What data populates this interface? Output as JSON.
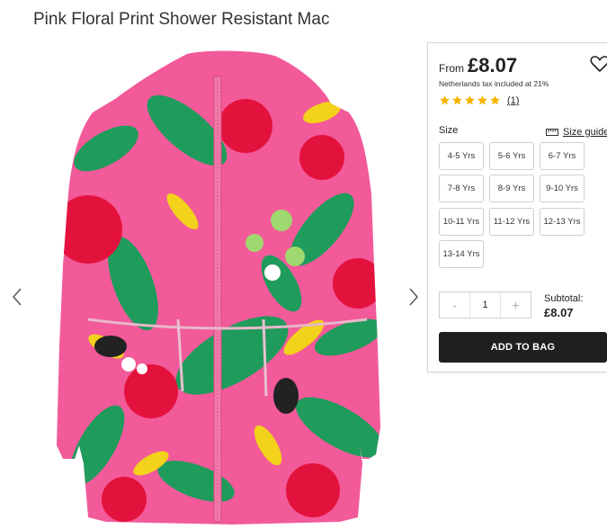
{
  "product": {
    "title": "Pink Floral Print Shower Resistant Mac"
  },
  "gallery": {
    "image_alt": "pink tropical floral print hooded jacket",
    "prev_icon": "chevron-left-icon",
    "next_icon": "chevron-right-icon"
  },
  "purchase": {
    "from_label": "From",
    "price": "£8.07",
    "tax_note": "Netherlands tax included at 21%",
    "rating": 5,
    "rating_max": 5,
    "review_count": "(1)",
    "size_label": "Size",
    "size_guide_label": "Size guide",
    "sizes": [
      "4-5 Yrs",
      "5-6 Yrs",
      "6-7 Yrs",
      "7-8 Yrs",
      "8-9 Yrs",
      "9-10 Yrs",
      "10-11 Yrs",
      "11-12 Yrs",
      "12-13 Yrs",
      "13-14 Yrs"
    ],
    "qty_minus": "-",
    "qty_value": "1",
    "qty_plus": "+",
    "subtotal_label": "Subtotal:",
    "subtotal_value": "£8.07",
    "add_to_bag": "ADD TO BAG"
  },
  "colors": {
    "star": "#f5b301",
    "button": "#1f1f1f",
    "jacket_pink": "#f25a9a"
  }
}
